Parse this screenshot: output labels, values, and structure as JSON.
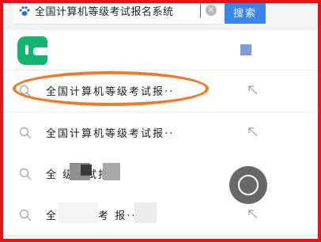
{
  "search": {
    "value": "全国计算机等级考试报名系统",
    "button_label": "搜索",
    "clear_symbol": "×"
  },
  "suggestions": [
    {
      "text": "全国计算机等级考试报··"
    },
    {
      "text": "全国计算机等级考试报··"
    },
    {
      "text": "全              级考试报··"
    },
    {
      "text": "全          机等级考    报··"
    }
  ],
  "icons": {
    "search_engine": "paw-icon",
    "app": "app-logo-icon",
    "row": "search-icon",
    "fill": "arrow-up-left-icon",
    "float": "assistive-touch-icon"
  },
  "colors": {
    "accent": "#3a86e9",
    "highlight": "#ef7a2b",
    "frame": "#e5141b"
  }
}
